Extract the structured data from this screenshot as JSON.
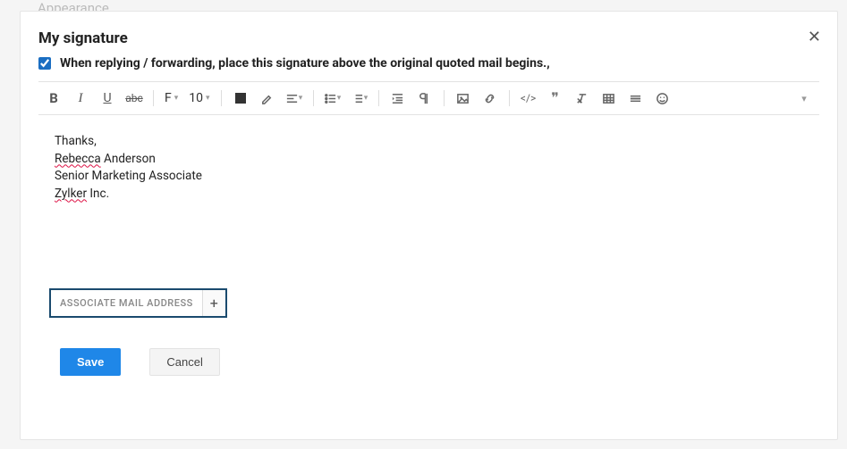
{
  "background_hint": "Appearance",
  "modal": {
    "title": "My signature",
    "checkbox_checked": true,
    "checkbox_label": "When replying / forwarding, place this signature above the original quoted mail begins.,",
    "toolbar": {
      "font_label": "F",
      "font_size": "10"
    },
    "signature": {
      "line1_a": "Thanks,",
      "line2_a": "Rebecca",
      "line2_b": " Anderson",
      "line3": "Senior Marketing Associate",
      "line4_a": "Zylker",
      "line4_b": " Inc."
    },
    "associate_label": "ASSOCIATE MAIL ADDRESS",
    "associate_plus": "+",
    "save_label": "Save",
    "cancel_label": "Cancel"
  }
}
